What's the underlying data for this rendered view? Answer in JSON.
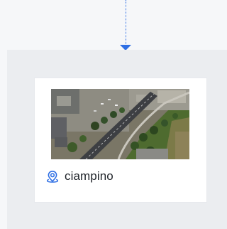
{
  "connector": {
    "color": "#2f6fe4",
    "arrow": "arrow-down-icon"
  },
  "card": {
    "thumbnail": "aerial-map-thumbnail",
    "icon": "location-pin-icon",
    "icon_color": "#2f6fe4",
    "location_name": "ciampino"
  }
}
